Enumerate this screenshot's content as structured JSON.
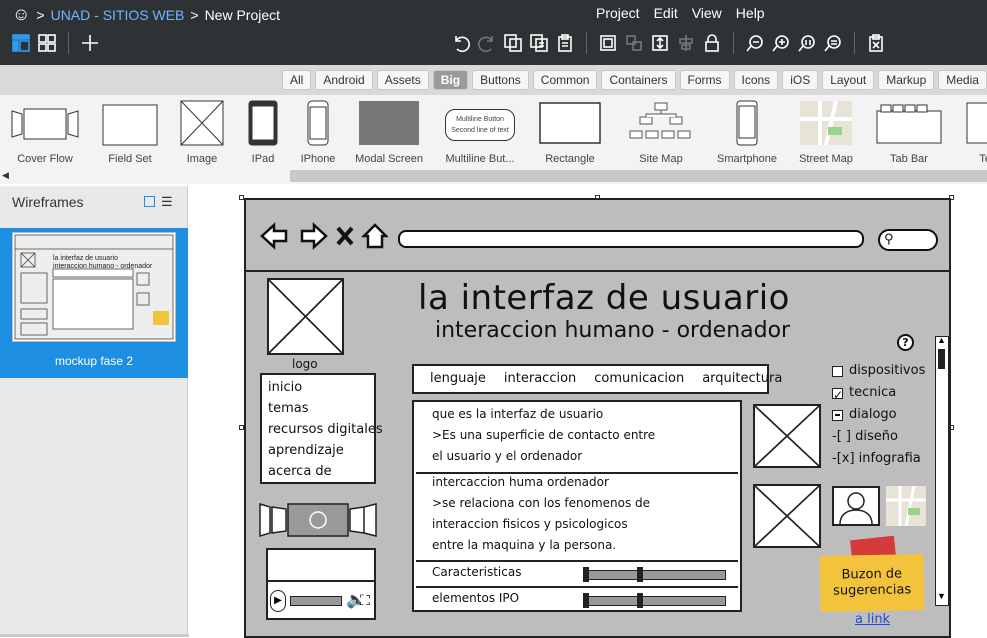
{
  "topbar": {
    "breadcrumb": {
      "project": "UNAD - SITIOS WEB",
      "separator": ">",
      "page": "New Project"
    },
    "menu": [
      "Project",
      "Edit",
      "View",
      "Help"
    ]
  },
  "categories": [
    "All",
    "Android",
    "Assets",
    "Big",
    "Buttons",
    "Common",
    "Containers",
    "Forms",
    "Icons",
    "iOS",
    "Layout",
    "Markup",
    "Media"
  ],
  "active_category": "Big",
  "gallery": [
    "Cover Flow",
    "Field Set",
    "Image",
    "IPad",
    "IPhone",
    "Modal Screen",
    "Multiline But...",
    "Rectangle",
    "Site Map",
    "Smartphone",
    "Street Map",
    "Tab Bar",
    "Te"
  ],
  "gallery_multiline_preview": [
    "Multiline Button",
    "Second line of text"
  ],
  "sidebar": {
    "title": "Wireframes",
    "mockup_label": "mockup fase 2"
  },
  "mockup": {
    "title": "la interfaz de usuario",
    "subtitle": "interaccion humano - ordenador",
    "logo_label": "logo",
    "nav": [
      "inicio",
      "temas",
      "recursos digitales",
      "aprendizaje",
      "acerca de"
    ],
    "tabs": [
      "lenguaje",
      "interaccion",
      "comunicacion",
      "arquitectura"
    ],
    "content_block1": [
      "que es la interfaz de usuario",
      ">Es una superficie de contacto entre",
      "el usuario y el ordenador"
    ],
    "content_block2": [
      "intercaccion huma ordenador",
      ">se relaciona con los fenomenos de",
      "interaccion fisicos y psicologicos",
      "entre la maquina y la persona."
    ],
    "accordion": [
      "Caracteristicas",
      "elementos IPO"
    ],
    "options": [
      {
        "label": "dispositivos",
        "state": "unchecked"
      },
      {
        "label": "tecnica",
        "state": "checked"
      },
      {
        "label": "dialogo",
        "state": "indeterminate"
      }
    ],
    "tree_items": [
      "-[ ] diseño",
      "-[x] infografia"
    ],
    "help_glyph": "?",
    "sticky_note": "Buzon de sugerencias",
    "link": "a link"
  },
  "colors": {
    "topbar": "#2f3235",
    "accent": "#1e8ee0",
    "link": "#6fb6ff",
    "sticky": "#f3c43b",
    "tape": "#d63b3b"
  }
}
